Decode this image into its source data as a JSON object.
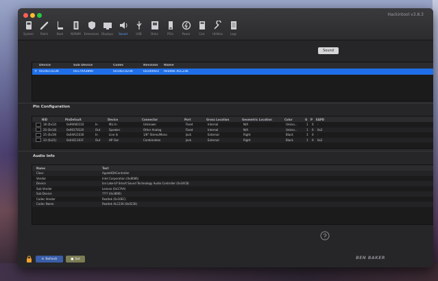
{
  "window": {
    "title": "Hackintool v3.8.3"
  },
  "toolbar": {
    "items": [
      {
        "label": "System",
        "icon": "system-icon"
      },
      {
        "label": "Patch",
        "icon": "patch-icon"
      },
      {
        "label": "Boot",
        "icon": "boot-icon"
      },
      {
        "label": "NVRAM",
        "icon": "nvram-icon"
      },
      {
        "label": "Extensions",
        "icon": "extensions-icon"
      },
      {
        "label": "Displays",
        "icon": "displays-icon"
      },
      {
        "label": "Sound",
        "icon": "sound-icon",
        "active": true
      },
      {
        "label": "USB",
        "icon": "usb-icon"
      },
      {
        "label": "Disks",
        "icon": "disks-icon"
      },
      {
        "label": "PCIe",
        "icon": "pcie-icon"
      },
      {
        "label": "Power",
        "icon": "power-icon"
      },
      {
        "label": "Calc",
        "icon": "calc-icon"
      },
      {
        "label": "Utilities",
        "icon": "utilities-icon"
      },
      {
        "label": "Logs",
        "icon": "logs-icon"
      }
    ]
  },
  "sound_button": "Sound",
  "codec_table": {
    "headers": [
      "Device",
      "Sub Device",
      "Codec",
      "Revision",
      "Name"
    ],
    "rows": [
      [
        "0x10EC0236",
        "0x17AA3890",
        "0x10EC0236",
        "0x100003",
        "Realtek ALC236"
      ]
    ]
  },
  "pin_section": {
    "title": "Pin Configuration",
    "headers": [
      "NID",
      "PinDefault",
      "",
      "Device",
      "Connector",
      "Port",
      "Gross Location",
      "Geometric Location",
      "Color",
      "G",
      "P",
      "EAPD"
    ],
    "rows": [
      [
        "18 (0x12)",
        "0x90A60110",
        "In",
        "Mic In",
        "Unknown",
        "Fixed",
        "Internal",
        "N/A",
        "Unkno...",
        "1",
        "0",
        "-"
      ],
      [
        "20 (0x14)",
        "0x90170120",
        "Out",
        "Speaker",
        "Other Analog",
        "Fixed",
        "Internal",
        "N/A",
        "Unkno...",
        "1",
        "0",
        "0x2"
      ],
      [
        "25 (0x19)",
        "0x04A11030",
        "In",
        "Line In",
        "1/8\" Stereo/Mono",
        "Jack",
        "External",
        "Right",
        "Black",
        "3",
        "0",
        "-"
      ],
      [
        "33 (0x21)",
        "0x0421101F",
        "Out",
        "HP Out",
        "Combination",
        "Jack",
        "External",
        "Right",
        "Black",
        "1",
        "0",
        "0x2"
      ]
    ]
  },
  "audio_section": {
    "title": "Audio Info",
    "headers": [
      "Name",
      "Text"
    ],
    "rows": [
      [
        "Class",
        "AppleHDAController"
      ],
      [
        "Vendor",
        "Intel Corporation (0x8086)"
      ],
      [
        "Device",
        "Ice Lake-LP Smart Sound Technology Audio Controller (0x34C8)"
      ],
      [
        "Sub Vendor",
        "Lenovo (0x17AA)"
      ],
      [
        "Sub Device",
        "???? (0x3890)"
      ],
      [
        "Codec Vendor",
        "Realtek (0x10EC)"
      ],
      [
        "Codec Name",
        "Realtek ALC236 (0x0236)"
      ]
    ]
  },
  "footer": {
    "button_a": "Refresh",
    "button_b": "Set",
    "brand": "BEN BAKER"
  },
  "colors": {
    "selection": "#1f6fe8",
    "accent": "#5aa0ff"
  }
}
